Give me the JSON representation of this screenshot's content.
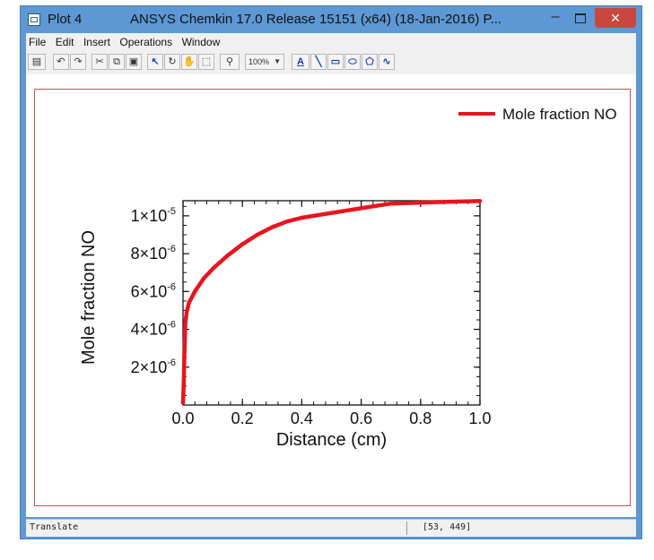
{
  "window": {
    "title": "Plot 4",
    "subtitle": "ANSYS Chemkin 17.0 Release 15151 (x64) (18-Jan-2016) P...",
    "minimize_symbol": "–",
    "close_symbol": "✕"
  },
  "menu": {
    "items": [
      "File",
      "Edit",
      "Insert",
      "Operations",
      "Window"
    ]
  },
  "toolbar": {
    "zoom": "100%",
    "text_tool": "A"
  },
  "chart_data": {
    "type": "line",
    "xlabel": "Distance (cm)",
    "ylabel": "Mole fraction NO",
    "xlim": [
      0.0,
      1.0
    ],
    "ylim": [
      0.0,
      1.08e-05
    ],
    "x_ticks": [
      "0.0",
      "0.2",
      "0.4",
      "0.6",
      "0.8",
      "1.0"
    ],
    "y_ticks": [
      {
        "mantissa": "2×10",
        "exp": "-6",
        "value": 2e-06
      },
      {
        "mantissa": "4×10",
        "exp": "-6",
        "value": 4e-06
      },
      {
        "mantissa": "6×10",
        "exp": "-6",
        "value": 6e-06
      },
      {
        "mantissa": "8×10",
        "exp": "-6",
        "value": 8e-06
      },
      {
        "mantissa": "1×10",
        "exp": "-5",
        "value": 1e-05
      }
    ],
    "legend_position": "top-right",
    "series": [
      {
        "name": "Mole fraction NO",
        "color": "#e8141e",
        "x": [
          0.0,
          0.002,
          0.004,
          0.006,
          0.008,
          0.012,
          0.02,
          0.04,
          0.07,
          0.1,
          0.15,
          0.2,
          0.25,
          0.3,
          0.35,
          0.4,
          0.5,
          0.6,
          0.7,
          0.8,
          0.9,
          1.0
        ],
        "y": [
          1.2e-07,
          1e-06,
          2.2e-06,
          3.4e-06,
          4.3e-06,
          4.9e-06,
          5.4e-06,
          6e-06,
          6.7e-06,
          7.2e-06,
          7.9e-06,
          8.5e-06,
          9e-06,
          9.4e-06,
          9.7e-06,
          9.9e-06,
          1.015e-05,
          1.04e-05,
          1.065e-05,
          1.07e-05,
          1.075e-05,
          1.078e-05
        ]
      }
    ]
  },
  "status": {
    "mode": "Translate",
    "coords": "[53, 449]"
  }
}
